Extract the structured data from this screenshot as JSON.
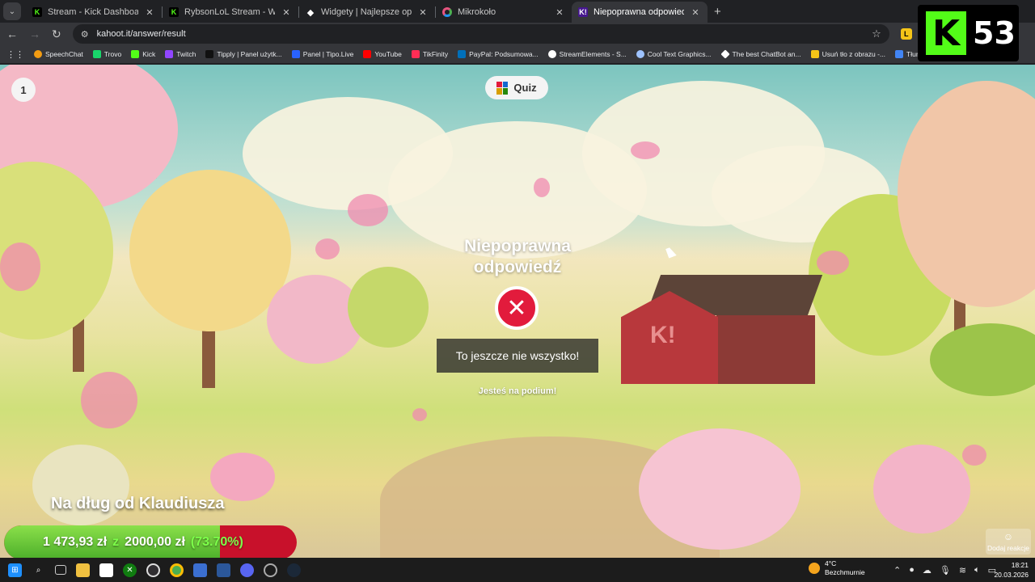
{
  "browser": {
    "tabs": [
      {
        "title": "Stream - Kick Dashboard",
        "favicon": "kick-icon",
        "active": false
      },
      {
        "title": "RybsonLoL Stream - Watch Live",
        "favicon": "kick-icon",
        "active": false
      },
      {
        "title": "Widgety | Najlepsze oprogram",
        "favicon": "diamond-icon",
        "active": false
      },
      {
        "title": "Mikrokoło",
        "favicon": "ring-icon",
        "active": false
      },
      {
        "title": "Niepoprawna odpowiedź - Kah",
        "favicon": "kahoot-icon",
        "active": true
      }
    ],
    "close_glyph": "✕",
    "new_tab_glyph": "+",
    "url": "kahoot.it/answer/result",
    "extension_letter": "L",
    "bookmarks": [
      "SpeechChat",
      "Trovo",
      "Kick",
      "Twitch",
      "Tipply | Panel użytk...",
      "Panel | Tipo.Live",
      "YouTube",
      "TikFinity",
      "PayPal: Podsumowa...",
      "StreamElements - S...",
      "Cool Text Graphics...",
      "The best ChatBot an...",
      "Usuń tło z obrazu -...",
      "Tłumacz"
    ]
  },
  "kahoot": {
    "question_number": "1",
    "quiz_label": "Quiz",
    "result_title": "Niepoprawna odpowiedź",
    "wrong_glyph": "✕",
    "message": "To jeszcze nie wszystko!",
    "podium": "Jesteś na podium!",
    "barn_logo": "K!"
  },
  "overlay": {
    "viewer_count": "53",
    "kick_letter": "K",
    "goal_title": "Na dług od Klaudiusza",
    "goal_current": "1 473,93 zł",
    "goal_separator": "z",
    "goal_target": "2000,00 zł",
    "goal_percent": "(73.70%)",
    "goal_fraction": 0.737,
    "react_label": "Dodaj reakcje"
  },
  "taskbar": {
    "weather_temp": "4°C",
    "weather_desc": "Bezchmurnie",
    "time": "18:21",
    "date": "20.03.2026"
  },
  "colors": {
    "kick_green": "#53fc18",
    "kahoot_red": "#e21b3c",
    "goal_green": "#4cae2a",
    "goal_red": "#c8112b"
  }
}
